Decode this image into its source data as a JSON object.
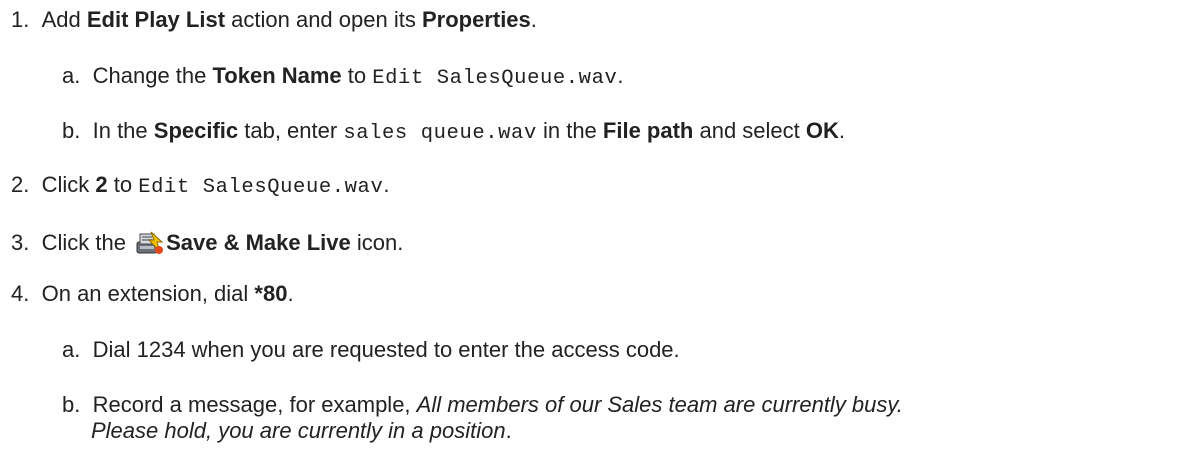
{
  "steps": {
    "s1": {
      "num": "1.",
      "t1": "Add ",
      "b1": "Edit Play List",
      "t2": " action and open its ",
      "b2": "Properties",
      "t3": ".",
      "a": {
        "num": "a.",
        "t1": "Change the ",
        "b1": "Token Name",
        "t2": " to ",
        "code": "Edit SalesQueue.wav",
        "t3": "."
      },
      "b": {
        "num": "b.",
        "t1": "In the ",
        "b1": "Specific",
        "t2": " tab, enter ",
        "code": "sales queue.wav",
        "t3": " in the ",
        "b2": "File path",
        "t4": " and select ",
        "b3": "OK",
        "t5": "."
      }
    },
    "s2": {
      "num": "2.",
      "t1": "Click ",
      "b1": "2",
      "t2": " to ",
      "code": "Edit SalesQueue.wav",
      "t3": "."
    },
    "s3": {
      "num": "3.",
      "t1": "Click the ",
      "icon": "save-make-live-icon",
      "b1": "Save & Make Live",
      "t2": " icon."
    },
    "s4": {
      "num": "4.",
      "t1": "On an extension, dial ",
      "b1": "*80",
      "t2": ".",
      "a": {
        "num": "a.",
        "t1": "Dial 1234 when you are requested to enter the access code."
      },
      "b": {
        "num": "b.",
        "t1": "Record a message, for example, ",
        "i1": "All members of our Sales team are currently busy.",
        "i2": "Please hold, you are currently in a position",
        "t2": "."
      }
    }
  }
}
